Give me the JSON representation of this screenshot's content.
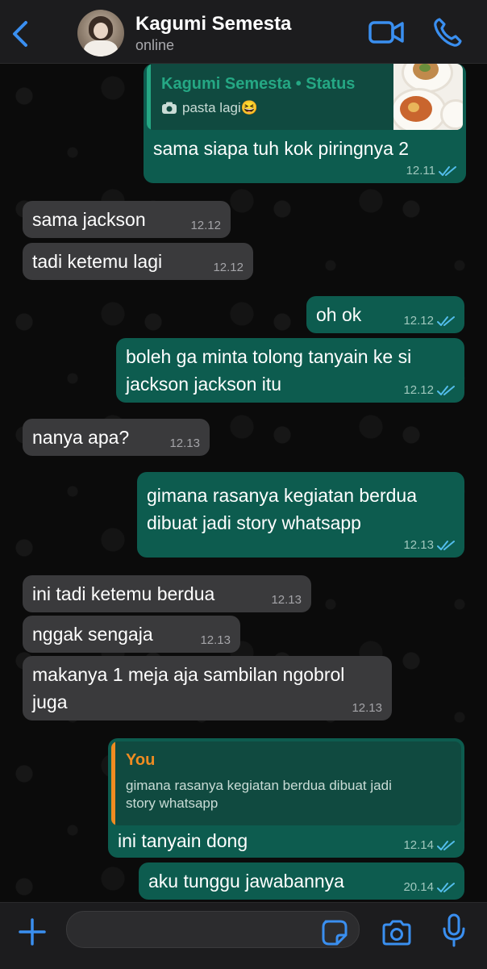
{
  "header": {
    "contact_name": "Kagumi Semesta",
    "contact_status": "online"
  },
  "colors": {
    "accent": "#3a8ff0",
    "incoming_bubble": "#3a3a3c",
    "outgoing_bubble": "#0d5c4f",
    "read_ticks": "#53bdeb",
    "quote_status": "#25a884",
    "quote_you": "#f08c21"
  },
  "messages": [
    {
      "type": "out",
      "quote": {
        "author": "Kagumi Semesta • Status",
        "text": "pasta lagi😆",
        "icon": "camera-icon"
      },
      "text": "sama siapa tuh kok piringnya 2",
      "time": "12.11",
      "read": true
    },
    {
      "type": "in",
      "text": "sama jackson",
      "time": "12.12"
    },
    {
      "type": "in",
      "text": "tadi ketemu lagi",
      "time": "12.12"
    },
    {
      "type": "out",
      "text": "oh ok",
      "time": "12.12",
      "read": true
    },
    {
      "type": "out",
      "text": "boleh ga minta tolong tanyain ke si\njackson jackson itu",
      "time": "12.12",
      "read": true
    },
    {
      "type": "in",
      "text": "nanya apa?",
      "time": "12.13"
    },
    {
      "type": "out",
      "text": "gimana rasanya kegiatan berdua\ndibuat jadi story whatsapp",
      "time": "12.13",
      "read": true
    },
    {
      "type": "in",
      "text": "ini tadi ketemu berdua",
      "time": "12.13"
    },
    {
      "type": "in",
      "text": "nggak sengaja",
      "time": "12.13"
    },
    {
      "type": "in",
      "text": "makanya 1 meja aja sambilan ngobrol\njuga",
      "time": "12.13"
    },
    {
      "type": "out",
      "quote": {
        "author": "You",
        "text": "gimana rasanya kegiatan berdua dibuat jadi\nstory whatsapp"
      },
      "text": "ini tanyain dong",
      "time": "12.14",
      "read": true
    },
    {
      "type": "out",
      "text": "aku tunggu jawabannya",
      "time": "20.14",
      "read": true
    }
  ]
}
